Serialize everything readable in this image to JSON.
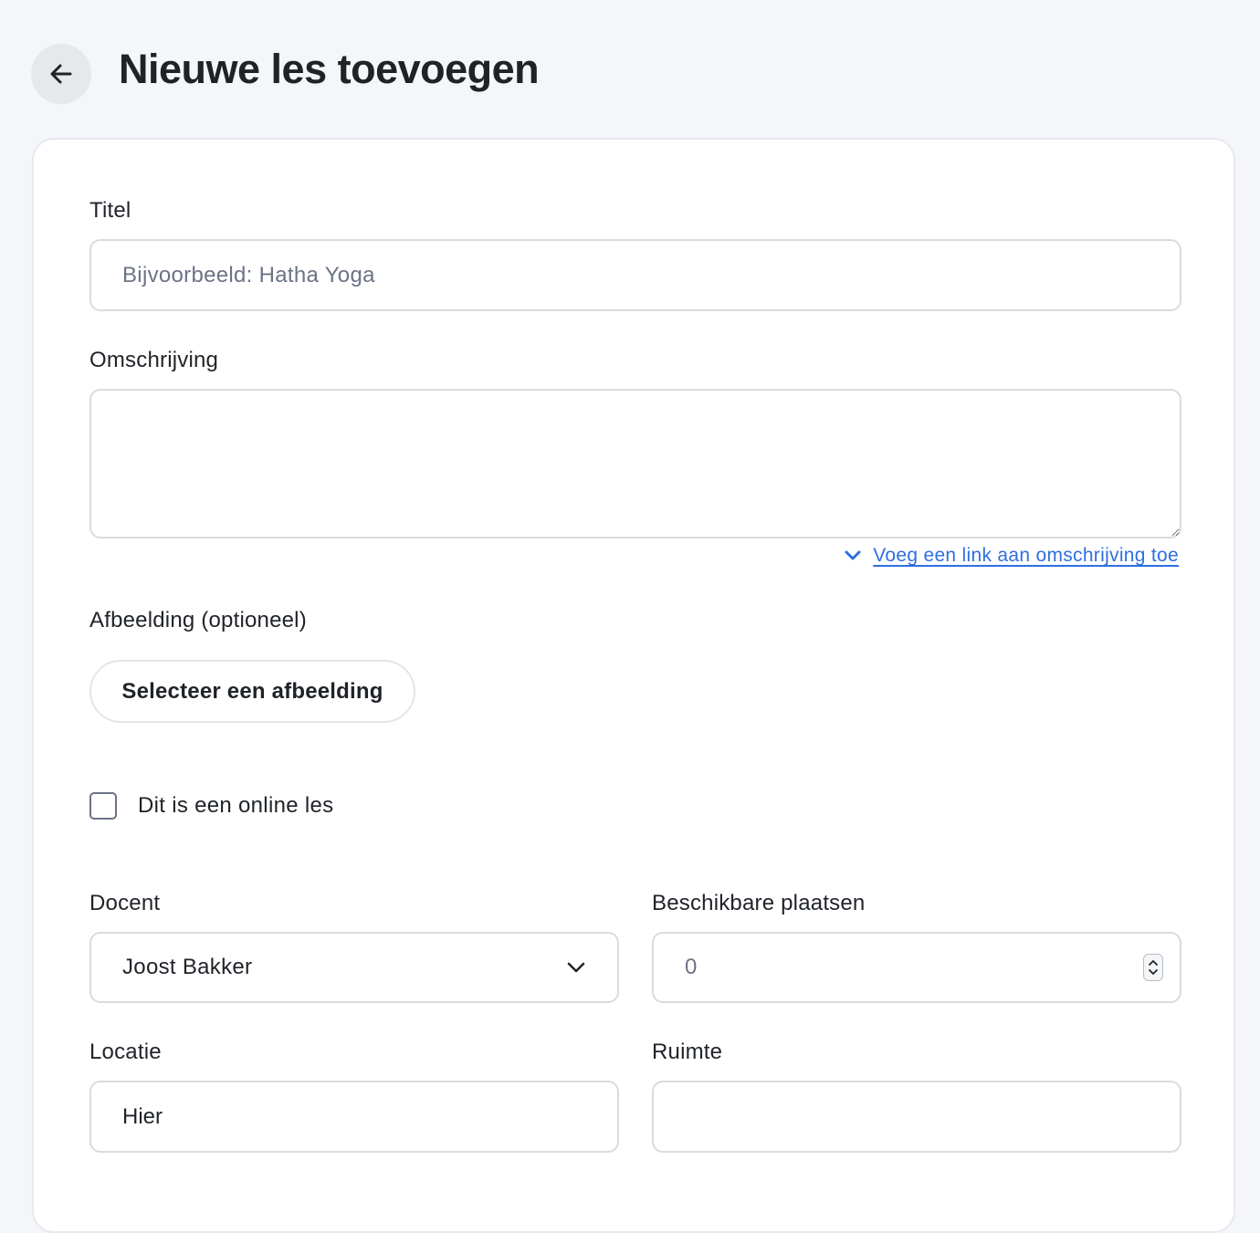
{
  "header": {
    "title": "Nieuwe les toevoegen",
    "back_icon": "arrow-left-icon"
  },
  "form": {
    "title": {
      "label": "Titel",
      "value": "",
      "placeholder": "Bijvoorbeeld: Hatha Yoga"
    },
    "description": {
      "label": "Omschrijving",
      "value": ""
    },
    "add_link": {
      "label": "Voeg een link aan omschrijving toe",
      "icon": "chevron-down-icon"
    },
    "image": {
      "label": "Afbeelding (optioneel)",
      "button_label": "Selecteer een afbeelding"
    },
    "online": {
      "label": "Dit is een online les",
      "checked": false
    },
    "teacher": {
      "label": "Docent",
      "selected": "Joost Bakker"
    },
    "capacity": {
      "label": "Beschikbare plaatsen",
      "value": "0"
    },
    "location": {
      "label": "Locatie",
      "value": "Hier"
    },
    "room": {
      "label": "Ruimte",
      "value": ""
    }
  },
  "colors": {
    "background": "#f5f6fa",
    "card": "#ffffff",
    "link": "#2f6fe0",
    "border": "#d9dbe0",
    "text": "#1f2328"
  }
}
